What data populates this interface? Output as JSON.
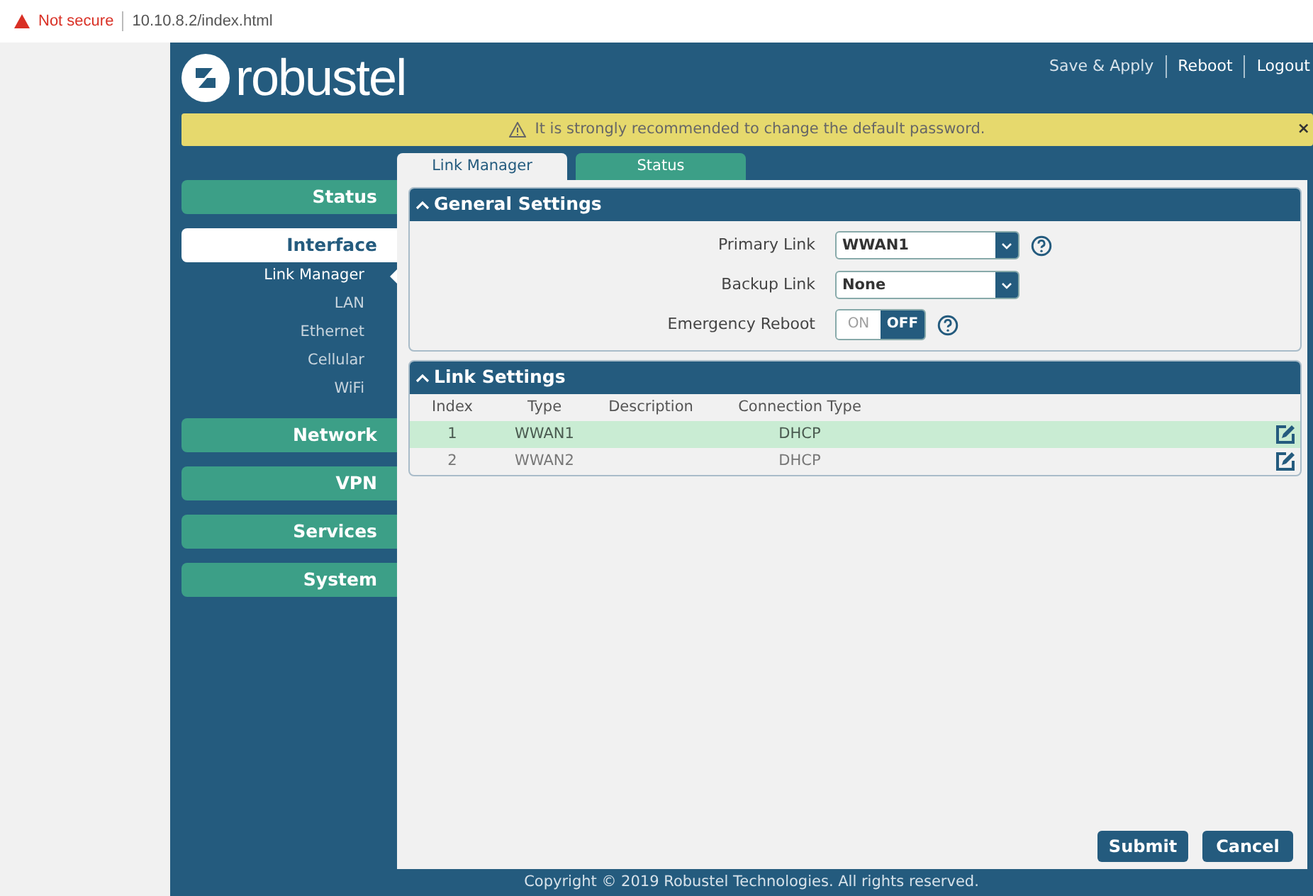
{
  "browser": {
    "security": "Not secure",
    "url": "10.10.8.2/index.html"
  },
  "header": {
    "logo_text": "robustel",
    "links": [
      "Save & Apply",
      "Reboot",
      "Logout"
    ]
  },
  "banner": {
    "message": "It is strongly recommended to change the default password.",
    "close": "×"
  },
  "sidebar": {
    "items": [
      {
        "label": "Status",
        "selected": false
      },
      {
        "label": "Interface",
        "selected": true,
        "children": [
          {
            "label": "Link Manager",
            "selected": true
          },
          {
            "label": "LAN",
            "selected": false
          },
          {
            "label": "Ethernet",
            "selected": false
          },
          {
            "label": "Cellular",
            "selected": false
          },
          {
            "label": "WiFi",
            "selected": false
          }
        ]
      },
      {
        "label": "Network",
        "selected": false
      },
      {
        "label": "VPN",
        "selected": false
      },
      {
        "label": "Services",
        "selected": false
      },
      {
        "label": "System",
        "selected": false
      }
    ]
  },
  "tabs": [
    {
      "label": "Link Manager",
      "selected": true
    },
    {
      "label": "Status",
      "selected": false
    }
  ],
  "general_settings": {
    "title": "General Settings",
    "expanded": true,
    "fields": [
      {
        "kind": "select",
        "label": "Primary Link",
        "value": "WWAN1",
        "help": true
      },
      {
        "kind": "select",
        "label": "Backup Link",
        "value": "None",
        "help": false
      },
      {
        "kind": "toggle",
        "label": "Emergency Reboot",
        "on": false,
        "on_label": "ON",
        "off_label": "OFF",
        "help": true
      }
    ]
  },
  "link_settings": {
    "title": "Link Settings",
    "expanded": true,
    "columns": [
      "Index",
      "Type",
      "Description",
      "Connection Type"
    ],
    "rows": [
      {
        "index": "1",
        "type": "WWAN1",
        "connection_type": "DHCP",
        "selected": true
      },
      {
        "index": "2",
        "type": "WWAN2",
        "connection_type": "DHCP",
        "selected": false
      }
    ]
  },
  "buttons": [
    "Submit",
    "Cancel"
  ],
  "footer": "Copyright © 2019 Robustel Technologies. All rights reserved."
}
